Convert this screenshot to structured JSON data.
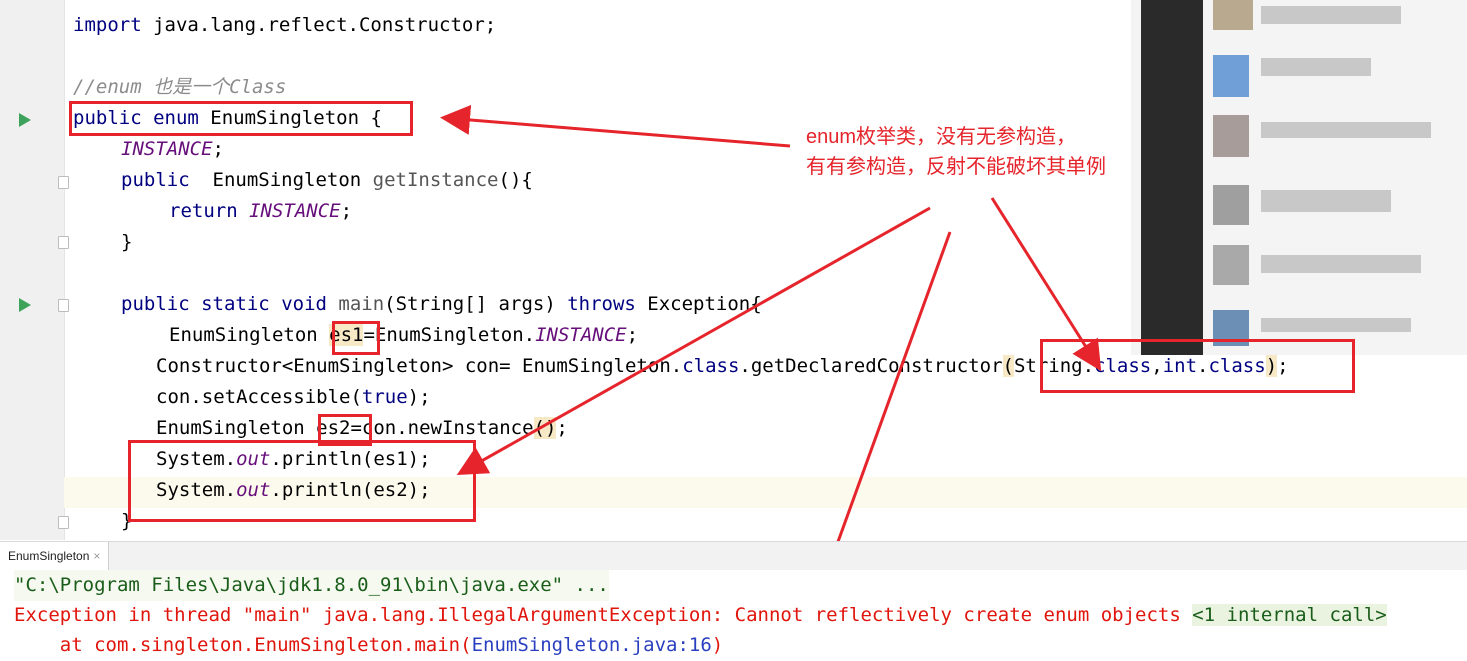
{
  "editor": {
    "lines": {
      "l1": {
        "kw": "import",
        "rest": " java.lang.reflect.Constructor;"
      },
      "l3": {
        "comment": "//enum 也是一个Class"
      },
      "l4": {
        "kw1": "public",
        "kw2": "enum",
        "name": " EnumSingleton {"
      },
      "l5": {
        "instance": "INSTANCE",
        "semi": ";"
      },
      "l6": {
        "kw": "public",
        "name": "  EnumSingleton ",
        "method": "getInstance",
        "rest": "(){"
      },
      "l7": {
        "kw": "return",
        "instance": "INSTANCE",
        "semi": ";"
      },
      "l8": {
        "text": "}"
      },
      "l10": {
        "kw1": "public",
        "kw2": "static",
        "kw3": "void",
        "method": "main",
        "args": "(String[] args) ",
        "kw4": "throws",
        "rest": " Exception{"
      },
      "l11": {
        "pre": "EnumSingleton ",
        "var": "es1",
        "mid": "=EnumSingleton.",
        "instance": "INSTANCE",
        "semi": ";"
      },
      "l12": {
        "pre": "Constructor<EnumSingleton> con= EnumSingleton.",
        "kw": "class",
        "mid": ".getDeclaredConstructor",
        "p1": "(",
        "a1": "String.",
        "kw2": "class",
        "comma": ",",
        "kw3": "int",
        "dot": ".",
        "kw4": "class",
        "p2": ")",
        "semi": ";"
      },
      "l13": {
        "pre": "con.setAccessible(",
        "kw": "true",
        "rest": ");"
      },
      "l14": {
        "pre": "EnumSingleton ",
        "var": "es2",
        "mid": "=con.newInstance",
        "paren": "()",
        "semi": ";"
      },
      "l15": {
        "pre": "System.",
        "out": "out",
        "rest": ".println(es1);"
      },
      "l16": {
        "pre": "System.",
        "out": "out",
        "rest": ".println(es2);"
      },
      "l17": {
        "text": "}"
      }
    }
  },
  "annotation": {
    "line1": "enum枚举类，没有无参构造，",
    "line2": "有有参构造，反射不能破坏其单例"
  },
  "run_panel": {
    "tab_label": "EnumSingleton",
    "close_glyph": "×"
  },
  "console": {
    "cmd": "\"C:\\Program Files\\Java\\jdk1.8.0_91\\bin\\java.exe\" ...",
    "exception_prefix": "Exception in thread \"main\" java.lang.IllegalArgumentException: ",
    "exception_message": "Cannot reflectively create enum objects",
    "internal_call": "<1 internal call>",
    "stack_pre": "    at com.singleton.EnumSingleton.main(",
    "stack_link": "EnumSingleton.java:16",
    "stack_post": ")"
  },
  "colors": {
    "keyword": "#000080",
    "static_field": "#660e7a",
    "comment": "#8c8c8c",
    "error": "#e0150c",
    "annotation_red": "#e5242b",
    "run_icon": "#3da35a"
  }
}
